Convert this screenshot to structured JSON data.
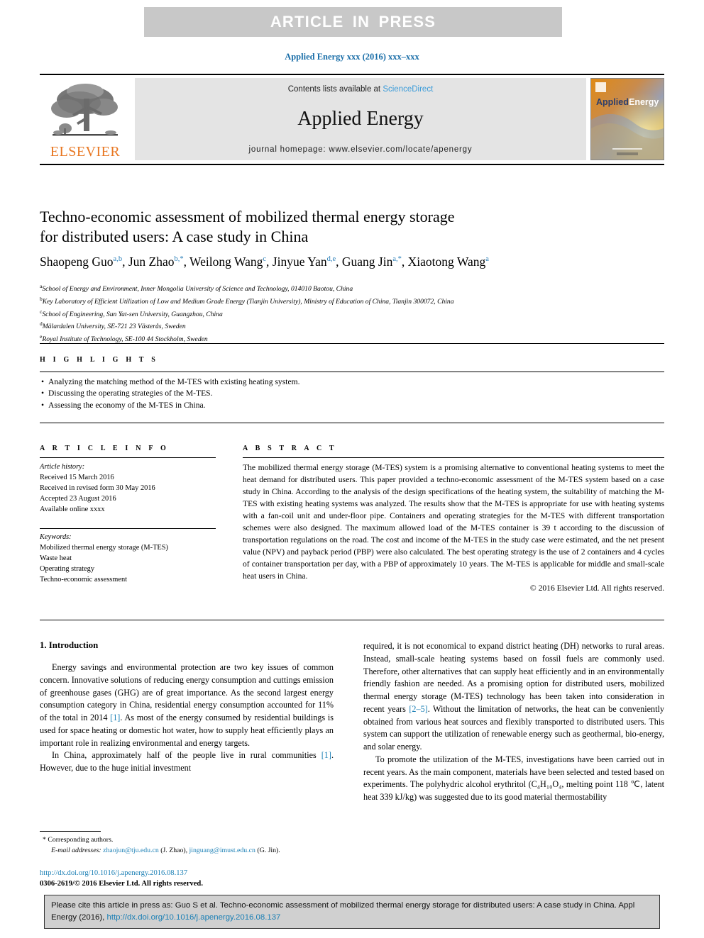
{
  "header": {
    "press_banner": "ARTICLE  IN  PRESS",
    "running_head": "Applied Energy xxx (2016) xxx–xxx"
  },
  "masthead": {
    "publisher_name": "ELSEVIER",
    "contents_prefix": "Contents lists available at ",
    "contents_link": "ScienceDirect",
    "journal_name": "Applied Energy",
    "homepage": "journal homepage: www.elsevier.com/locate/apenergy",
    "cover_title_a": "Applied",
    "cover_title_b": "Energy"
  },
  "article": {
    "title_line1": "Techno-economic assessment of mobilized thermal energy storage",
    "title_line2": "for distributed users: A case study in China",
    "authors": [
      {
        "name": "Shaopeng Guo",
        "sup": "a,b"
      },
      {
        "name": "Jun Zhao",
        "sup": "b,*"
      },
      {
        "name": "Weilong Wang",
        "sup": "c"
      },
      {
        "name": "Jinyue Yan",
        "sup": "d,e"
      },
      {
        "name": "Guang Jin",
        "sup": "a,*"
      },
      {
        "name": "Xiaotong Wang",
        "sup": "a"
      }
    ],
    "affiliations": [
      {
        "mark": "a",
        "text": "School of Energy and Environment, Inner Mongolia University of Science and Technology, 014010 Baotou, China"
      },
      {
        "mark": "b",
        "text": "Key Laboratory of Efficient Utilization of Low and Medium Grade Energy (Tianjin University), Ministry of Education of China, Tianjin 300072, China"
      },
      {
        "mark": "c",
        "text": "School of Engineering, Sun Yat-sen University, Guangzhou, China"
      },
      {
        "mark": "d",
        "text": "Mälardalen University, SE-721 23 Västerås, Sweden"
      },
      {
        "mark": "e",
        "text": "Royal Institute of Technology, SE-100 44 Stockholm, Sweden"
      }
    ]
  },
  "highlights": {
    "heading": "H I G H L I G H T S",
    "items": [
      "Analyzing the matching method of the M-TES with existing heating system.",
      "Discussing the operating strategies of the M-TES.",
      "Assessing the economy of the M-TES in China."
    ]
  },
  "article_info": {
    "heading": "A R T I C L E   I N F O",
    "history_label": "Article history:",
    "history": [
      "Received 15 March 2016",
      "Received in revised form 30 May 2016",
      "Accepted 23 August 2016",
      "Available online xxxx"
    ],
    "keywords_label": "Keywords:",
    "keywords": [
      "Mobilized thermal energy storage (M-TES)",
      "Waste heat",
      "Operating strategy",
      "Techno-economic assessment"
    ]
  },
  "abstract": {
    "heading": "A B S T R A C T",
    "text": "The mobilized thermal energy storage (M-TES) system is a promising alternative to conventional heating systems to meet the heat demand for distributed users. This paper provided a techno-economic assessment of the M-TES system based on a case study in China. According to the analysis of the design specifications of the heating system, the suitability of matching the M-TES with existing heating systems was analyzed. The results show that the M-TES is appropriate for use with heating systems with a fan-coil unit and under-floor pipe. Containers and operating strategies for the M-TES with different transportation schemes were also designed. The maximum allowed load of the M-TES container is 39 t according to the discussion of transportation regulations on the road. The cost and income of the M-TES in the study case were estimated, and the net present value (NPV) and payback period (PBP) were also calculated. The best operating strategy is the use of 2 containers and 4 cycles of container transportation per day, with a PBP of approximately 10 years. The M-TES is applicable for middle and small-scale heat users in China.",
    "copyright": "© 2016 Elsevier Ltd. All rights reserved."
  },
  "body": {
    "section_title": "1. Introduction",
    "left_p1_a": "Energy savings and environmental protection are two key issues of common concern. Innovative solutions of reducing energy consumption and cuttings emission of greenhouse gases (GHG) are of great importance. As the second largest energy consumption category in China, residential energy consumption accounted for 11% of the total in 2014 ",
    "left_p1_ref": "[1]",
    "left_p1_b": ". As most of the energy consumed by residential buildings is used for space heating or domestic hot water, how to supply heat efficiently plays an important role in realizing environmental and energy targets.",
    "left_p2_a": "In China, approximately half of the people live in rural communities ",
    "left_p2_ref": "[1]",
    "left_p2_b": ". However, due to the huge initial investment",
    "right_p1_a": "required, it is not economical to expand district heating (DH) networks to rural areas. Instead, small-scale heating systems based on fossil fuels are commonly used. Therefore, other alternatives that can supply heat efficiently and in an environmentally friendly fashion are needed. As a promising option for distributed users, mobilized thermal energy storage (M-TES) technology has been taken into consideration in recent years ",
    "right_p1_ref": "[2–5]",
    "right_p1_b": ". Without the limitation of networks, the heat can be conveniently obtained from various heat sources and flexibly transported to distributed users. This system can support the utilization of renewable energy such as geothermal, bio-energy, and solar energy.",
    "right_p2": "To promote the utilization of the M-TES, investigations have been carried out in recent years. As the main component, materials have been selected and tested based on experiments. The polyhydric alcohol erythritol (C₄H₁₀O₄, melting point 118 ℃, latent heat 339 kJ/kg) was suggested due to its good material thermostability"
  },
  "footnote": {
    "star": "*",
    "corresponding": "Corresponding authors.",
    "email_label": "E-mail addresses:",
    "email1": "zhaojun@tju.edu.cn",
    "email1_owner": "(J. Zhao),",
    "email2": "jinguang@imust.edu.cn",
    "email2_owner": "(G. Jin).",
    "doi": "http://dx.doi.org/10.1016/j.apenergy.2016.08.137",
    "issn": "0306-2619/© 2016 Elsevier Ltd. All rights reserved."
  },
  "cite_box": {
    "text_a": "Please cite this article in press as: Guo S et al. Techno-economic assessment of mobilized thermal energy storage for distributed users: A case study in China. Appl Energy (2016), ",
    "link": "http://dx.doi.org/10.1016/j.apenergy.2016.08.137"
  },
  "colors": {
    "link": "#1a7fb5",
    "banner_bg": "#c8c8c8",
    "elsevier_orange": "#E87722"
  }
}
